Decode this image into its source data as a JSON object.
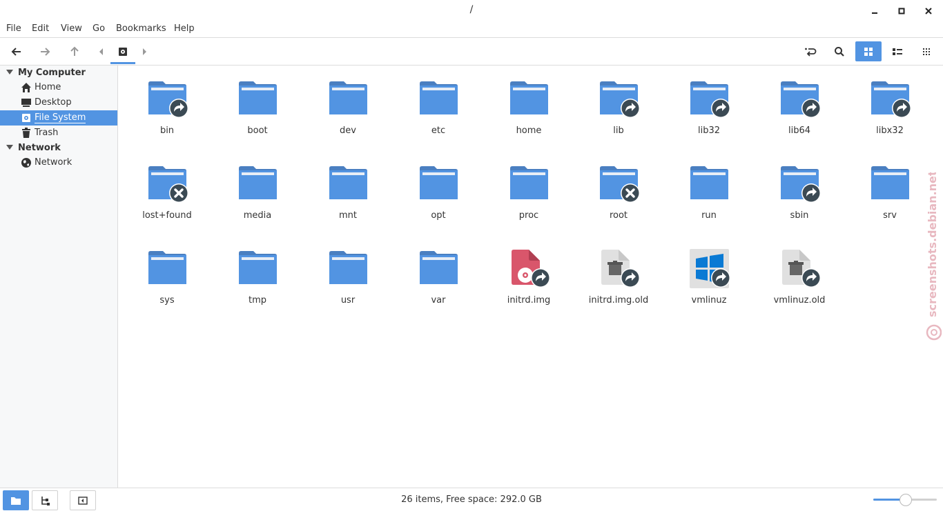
{
  "window": {
    "title": "/"
  },
  "menu": {
    "items": [
      "File",
      "Edit",
      "View",
      "Go",
      "Bookmarks",
      "Help"
    ]
  },
  "colors": {
    "accent": "#5294e2",
    "folder": "#5294e2",
    "folder_tab": "#4a7fc1",
    "badge": "#3b4a54"
  },
  "sidebar": {
    "sections": [
      {
        "heading": "My Computer",
        "items": [
          {
            "label": "Home",
            "icon": "home-icon"
          },
          {
            "label": "Desktop",
            "icon": "desktop-icon"
          },
          {
            "label": "File System",
            "icon": "drive-icon",
            "selected": true
          },
          {
            "label": "Trash",
            "icon": "trash-icon"
          }
        ]
      },
      {
        "heading": "Network",
        "items": [
          {
            "label": "Network",
            "icon": "globe-icon"
          }
        ]
      }
    ]
  },
  "files": [
    {
      "name": "bin",
      "type": "folder",
      "badge": "link"
    },
    {
      "name": "boot",
      "type": "folder",
      "badge": ""
    },
    {
      "name": "dev",
      "type": "folder",
      "badge": ""
    },
    {
      "name": "etc",
      "type": "folder",
      "badge": ""
    },
    {
      "name": "home",
      "type": "folder",
      "badge": ""
    },
    {
      "name": "lib",
      "type": "folder",
      "badge": "link"
    },
    {
      "name": "lib32",
      "type": "folder",
      "badge": "link"
    },
    {
      "name": "lib64",
      "type": "folder",
      "badge": "link"
    },
    {
      "name": "libx32",
      "type": "folder",
      "badge": "link"
    },
    {
      "name": "lost+found",
      "type": "folder",
      "badge": "noaccess"
    },
    {
      "name": "media",
      "type": "folder",
      "badge": ""
    },
    {
      "name": "mnt",
      "type": "folder",
      "badge": ""
    },
    {
      "name": "opt",
      "type": "folder",
      "badge": ""
    },
    {
      "name": "proc",
      "type": "folder",
      "badge": ""
    },
    {
      "name": "root",
      "type": "folder",
      "badge": "noaccess"
    },
    {
      "name": "run",
      "type": "folder",
      "badge": ""
    },
    {
      "name": "sbin",
      "type": "folder",
      "badge": "link"
    },
    {
      "name": "srv",
      "type": "folder",
      "badge": ""
    },
    {
      "name": "sys",
      "type": "folder",
      "badge": ""
    },
    {
      "name": "tmp",
      "type": "folder",
      "badge": ""
    },
    {
      "name": "usr",
      "type": "folder",
      "badge": ""
    },
    {
      "name": "var",
      "type": "folder",
      "badge": ""
    },
    {
      "name": "initrd.img",
      "type": "disc-image",
      "badge": "link"
    },
    {
      "name": "initrd.img.old",
      "type": "package",
      "badge": "link"
    },
    {
      "name": "vmlinuz",
      "type": "windows",
      "badge": "link"
    },
    {
      "name": "vmlinuz.old",
      "type": "package",
      "badge": "link"
    }
  ],
  "status": {
    "text": "26 items, Free space: 292.0 GB",
    "zoom_level": 0.5
  },
  "watermark": {
    "text": "screenshots.debian.net"
  }
}
